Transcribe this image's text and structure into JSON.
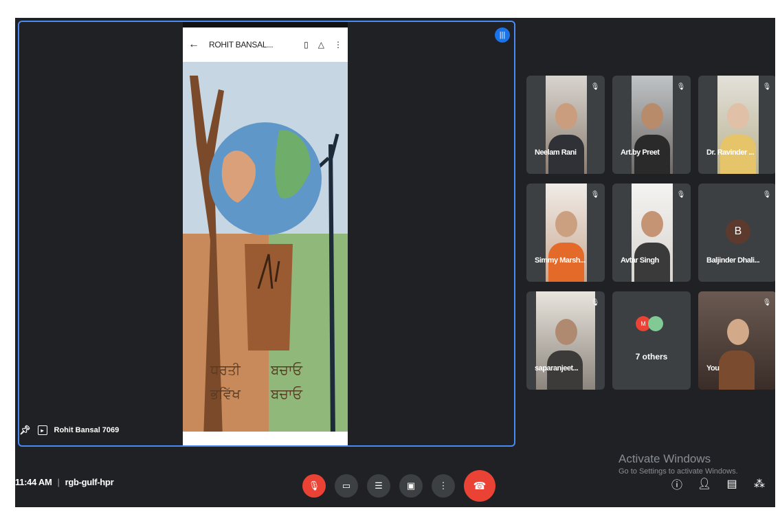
{
  "presentation": {
    "phone_title": "ROHIT BANSAL...",
    "presenter_name": "Rohit Bansal 7069"
  },
  "participants": [
    {
      "name": "Neelam Rani",
      "muted": true
    },
    {
      "name": "Art.by Preet",
      "muted": true
    },
    {
      "name": "Dr. Ravinder ...",
      "muted": true
    },
    {
      "name": "Simmy Marsh...",
      "muted": true
    },
    {
      "name": "Avtar Singh",
      "muted": true
    },
    {
      "name": "Baljinder Dhali...",
      "avatar_initial": "B",
      "muted": true
    },
    {
      "name": "saparanjeet...",
      "muted": true
    },
    {
      "others_label": "7 others"
    },
    {
      "name": "You",
      "muted": true
    }
  ],
  "meeting": {
    "time": "11:44 AM",
    "code": "rgb-gulf-hpr"
  },
  "watermark": {
    "title": "Activate Windows",
    "subtitle": "Go to Settings to activate Windows."
  },
  "colors": {
    "background": "#202124",
    "tile": "#3c4043",
    "accent": "#1a73e8",
    "danger": "#ea4335"
  }
}
